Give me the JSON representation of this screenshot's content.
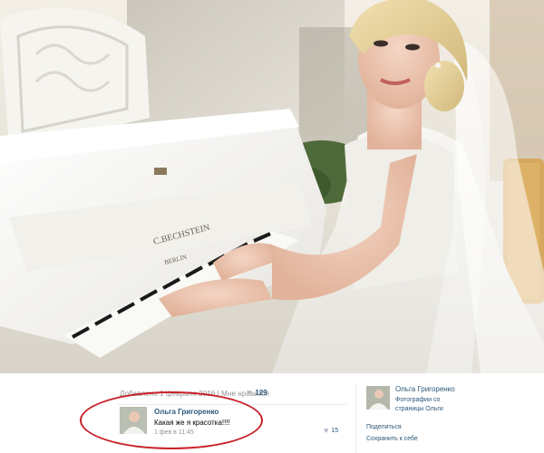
{
  "post": {
    "meta_line": "Добавлено 1 февраля 2016 | Мне нравится",
    "likes": "129"
  },
  "comment": {
    "author": "Ольга Григоренко",
    "text": "Какая же я красотка!!!!",
    "date": "1 фев в 11:45",
    "likes": "15"
  },
  "sidebar": {
    "owner": "Ольга Григоренко",
    "album": "Фотографии со страницы Ольги",
    "share": "Поделиться",
    "save": "Сохранить к себе"
  },
  "photo": {
    "piano_brand": "C.BECHSTEIN",
    "piano_city": "BERLIN"
  },
  "colors": {
    "link": "#2b587a",
    "muted": "#939393",
    "annotation": "#c8202a"
  },
  "icons": [
    "heart-icon"
  ]
}
